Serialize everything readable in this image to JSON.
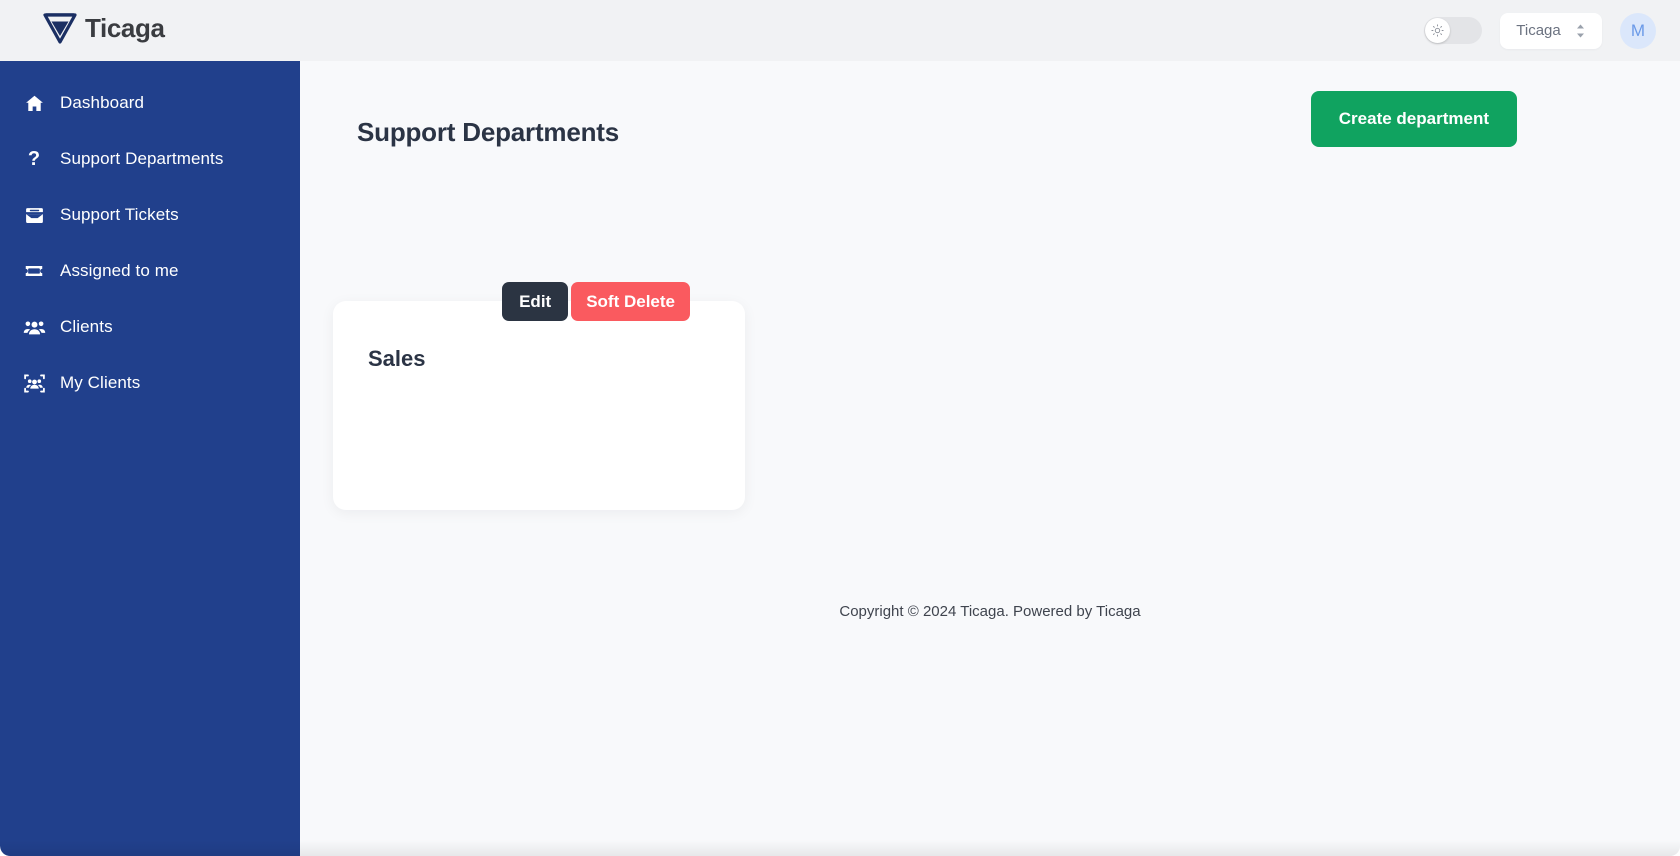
{
  "brand": {
    "name": "Ticaga",
    "logo_icon": "triangle-logo-icon",
    "logo_color": "#1b2f63"
  },
  "header": {
    "theme_toggle": {
      "icon": "sun-icon",
      "state": "off"
    },
    "tenant_select": {
      "value": "Ticaga",
      "chevron_icon": "chevron-up-down-icon"
    },
    "avatar": {
      "initial": "M",
      "bg": "#dbe7fb",
      "fg": "#6b9ae8"
    }
  },
  "sidebar": {
    "bg": "#21408c",
    "items": [
      {
        "label": "Dashboard",
        "icon": "home-icon"
      },
      {
        "label": "Support Departments",
        "icon": "question-mark-icon"
      },
      {
        "label": "Support Tickets",
        "icon": "inbox-icon"
      },
      {
        "label": "Assigned to me",
        "icon": "ticket-icon"
      },
      {
        "label": "Clients",
        "icon": "users-icon"
      },
      {
        "label": "My Clients",
        "icon": "users-viewfinder-icon"
      }
    ]
  },
  "main": {
    "page_title": "Support Departments",
    "create_button": {
      "label": "Create department",
      "color": "#10a360"
    },
    "departments": [
      {
        "name": "Sales",
        "edit_label": "Edit",
        "edit_color": "#2b3442",
        "delete_label": "Soft Delete",
        "delete_color": "#fa5a5f"
      }
    ],
    "footer": "Copyright © 2024 Ticaga. Powered by Ticaga"
  }
}
